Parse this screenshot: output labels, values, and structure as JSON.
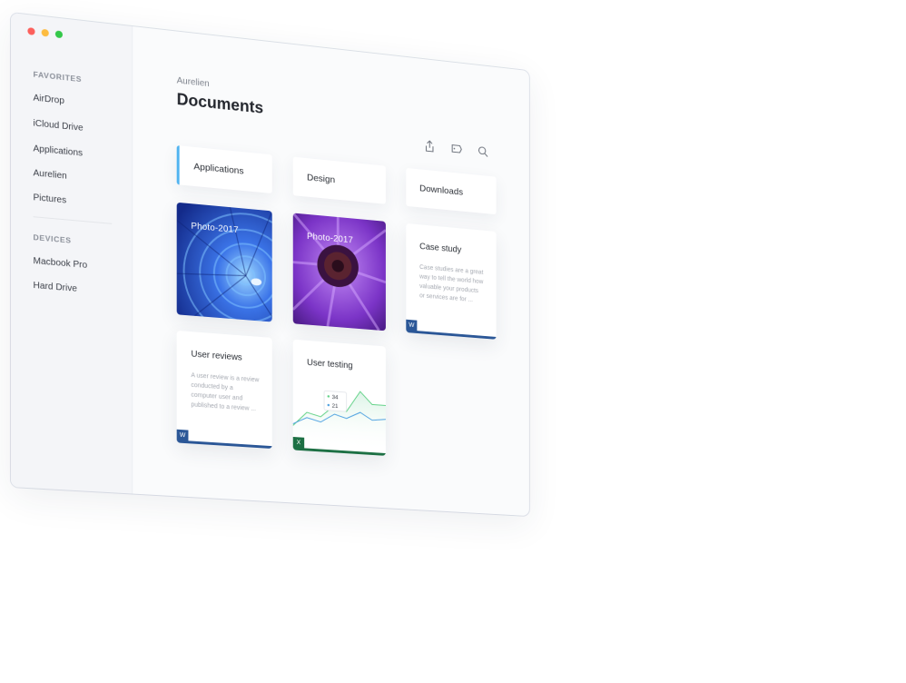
{
  "window": {
    "traffic_lights": [
      "#fc605c",
      "#fdbc40",
      "#34c84a"
    ]
  },
  "sidebar": {
    "favorites_title": "FAVORITES",
    "favorites": [
      {
        "label": "AirDrop"
      },
      {
        "label": "iCloud Drive"
      },
      {
        "label": "Applications"
      },
      {
        "label": "Aurelien"
      },
      {
        "label": "Pictures"
      }
    ],
    "devices_title": "DEVICES",
    "devices": [
      {
        "label": "Macbook Pro"
      },
      {
        "label": "Hard Drive"
      }
    ]
  },
  "header": {
    "breadcrumb": "Aurelien",
    "title": "Documents",
    "icons": [
      "share-icon",
      "tag-icon",
      "search-icon"
    ]
  },
  "folders": [
    {
      "label": "Applications",
      "active": true
    },
    {
      "label": "Design",
      "active": false
    },
    {
      "label": "Downloads",
      "active": false
    }
  ],
  "files": {
    "photo1": {
      "label": "Photo-2017",
      "color": "#2a5ad8"
    },
    "photo2": {
      "label": "Photo-2017",
      "color": "#8a3fd0"
    },
    "case_study": {
      "title": "Case study",
      "desc": "Case studies are a great way to tell the world how valuable your products or services are for ...",
      "badge": "W",
      "accent": "#2b5797"
    },
    "user_reviews": {
      "title": "User reviews",
      "desc": "A user review is a review conducted by a computer user and published to a review ...",
      "badge": "W",
      "accent": "#2b5797"
    },
    "user_testing": {
      "title": "User testing",
      "badge": "X",
      "accent": "#1d7044",
      "tooltip_a": "34",
      "tooltip_b": "21"
    }
  }
}
